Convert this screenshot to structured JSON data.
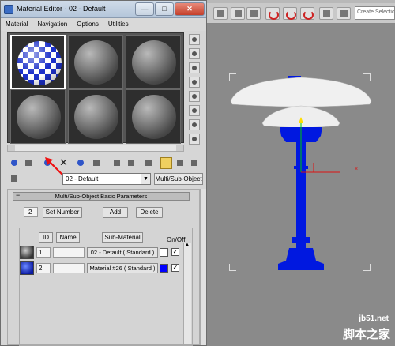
{
  "window": {
    "title": "Material Editor - 02 - Default",
    "minimize": "—",
    "maximize": "□",
    "close": "✕"
  },
  "menu": [
    "Material",
    "Navigation",
    "Options",
    "Utilities"
  ],
  "app_toolbar": {
    "search_placeholder": "Create Selectio"
  },
  "material": {
    "name": "02 - Default",
    "type": "Multi/Sub-Object"
  },
  "rollout": {
    "title": "Multi/Sub-Object Basic Parameters",
    "count": "2",
    "set_number": "Set Number",
    "add": "Add",
    "delete": "Delete",
    "headers": {
      "id": "ID",
      "name": "Name",
      "sub_material": "Sub-Material",
      "on_off": "On/Off"
    },
    "rows": [
      {
        "id": "1",
        "name": "",
        "sub_material": "02 - Default  ( Standard )",
        "swatch": "#ffffff",
        "checked": "✓"
      },
      {
        "id": "2",
        "name": "",
        "sub_material": "Material #26  ( Standard )",
        "swatch": "#0000ff",
        "checked": "✓"
      }
    ]
  },
  "colors": {
    "model_blue": "#0018e0",
    "shade_white": "#f2f2f2",
    "accent_red": "#dd1111"
  },
  "watermark": {
    "url": "jb51.net",
    "brand": "脚本之家"
  }
}
